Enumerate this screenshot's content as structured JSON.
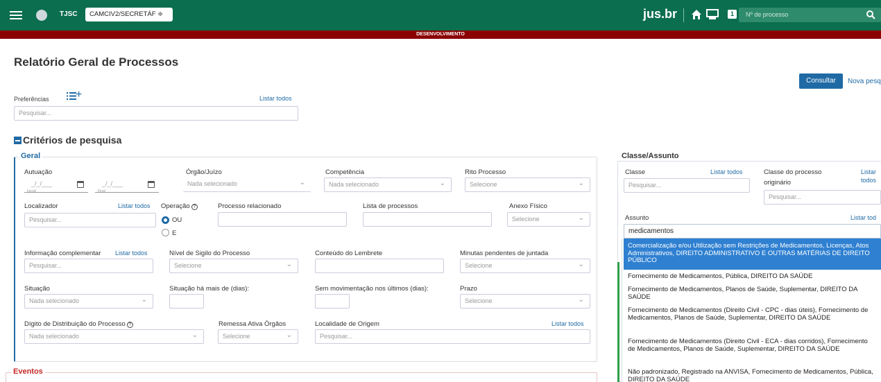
{
  "topbar": {
    "court": "TJSC",
    "location_select": "CAMCIV2/SECRETÁF ≑",
    "brand": "jus.br",
    "notifications_count": "1",
    "process_search_placeholder": "Nº de processo",
    "environment": "DESENVOLVIMENTO"
  },
  "page": {
    "title": "Relatório Geral de Processos",
    "consultar_label": "Consultar",
    "nova_pesquisa_label": "Nova pesq"
  },
  "preferences": {
    "label": "Preferências",
    "list_all": "Listar todos",
    "search_placeholder": "Pesquisar..."
  },
  "criteria": {
    "title": "Critérios de pesquisa",
    "geral": {
      "legend": "Geral",
      "autuacao": {
        "label": "Autuação",
        "start_placeholder": "_/_/___",
        "start_caption": "Inicial",
        "end_placeholder": "_/_/___",
        "end_caption": "Final"
      },
      "orgao": {
        "label": "Órgão/Juízo",
        "value": "Nada selecionado"
      },
      "competencia": {
        "label": "Competência",
        "value": "Nada selecionado"
      },
      "rito": {
        "label": "Rito Processo",
        "value": "Selecione"
      },
      "localizador": {
        "label": "Localizador",
        "list_all": "Listar todos",
        "placeholder": "Pesquisar..."
      },
      "operacao": {
        "label": "Operação",
        "opt_ou": "OU",
        "opt_e": "E"
      },
      "processo_relacionado": {
        "label": "Processo relacionado"
      },
      "lista_processos": {
        "label": "Lista de processos"
      },
      "anexo_fisico": {
        "label": "Anexo Físico",
        "value": "Selecione"
      },
      "info_complementar": {
        "label": "Informação complementar",
        "list_all": "Listar todos",
        "placeholder": "Pesquisar..."
      },
      "nivel_sigilo": {
        "label": "Nível de Sigilo do Processo",
        "value": "Selecione"
      },
      "conteudo_lembrete": {
        "label": "Conteúdo do Lembrete"
      },
      "minutas": {
        "label": "Minutas pendentes de juntada",
        "value": "Selecione"
      },
      "situacao": {
        "label": "Situação",
        "value": "Nada selecionado"
      },
      "situacao_dias": {
        "label": "Situação há mais de (dias):"
      },
      "sem_movimentacao": {
        "label": "Sem movimentação nos últimos (dias):"
      },
      "prazo": {
        "label": "Prazo",
        "value": "Selecione"
      },
      "digito": {
        "label": "Dígito de Distribuição do Processo",
        "value": "Nada selecionado"
      },
      "remessa": {
        "label": "Remessa Ativa Órgãos",
        "value": "Selecione"
      },
      "localidade": {
        "label": "Localidade de Origem",
        "list_all": "Listar todos",
        "placeholder": "Pesquisar..."
      }
    },
    "eventos": {
      "legend": "Eventos"
    }
  },
  "classe_assunto": {
    "legend": "Classe/Assunto",
    "classe": {
      "label": "Classe",
      "list_all": "Listar todos",
      "placeholder": "Pesquisar..."
    },
    "classe_originario": {
      "label_line1": "Classe do processo",
      "label_line2": "originário",
      "list_all_line1": "Listar",
      "list_all_line2": "todos",
      "placeholder": "Pesquisar..."
    },
    "assunto": {
      "label": "Assunto",
      "list_all": "Listar tod",
      "value": "medicamentos"
    },
    "suggestions": [
      "Comercialização e/ou Utilização sem Restrições de Medicamentos, Licenças, Atos Administrativos, DIREITO ADMINISTRATIVO E OUTRAS MATÉRIAS DE DIREITO PÚBLICO",
      "Fornecimento de Medicamentos, Pública, DIREITO DA SAÚDE",
      "Fornecimento de Medicamentos, Planos de Saúde, Suplementar, DIREITO DA SAÚDE",
      "Fornecimento de Medicamentos (Direito Civil - CPC - dias úteis), Fornecimento de Medicamentos, Planos de Saúde, Suplementar, DIREITO DA SAÚDE",
      "Fornecimento de Medicamentos (Direito Civil - ECA - dias corridos), Fornecimento de Medicamentos, Planos de Saúde, Suplementar, DIREITO DA SAÚDE",
      "Não padronizado, Registrado na ANVISA, Fornecimento de Medicamentos, Pública, DIREITO DA SAÚDE"
    ]
  },
  "colors": {
    "topbar": "#0b6e4f",
    "dev_strip": "#8b0000",
    "primary": "#1f6aa5",
    "highlight": "#2f80d1"
  },
  "icons": [
    "menu-icon",
    "logo-icon",
    "home-icon",
    "control-panel-icon",
    "search-icon",
    "list-icon",
    "plus-icon",
    "calendar-icon",
    "help-icon",
    "collapse-icon"
  ]
}
